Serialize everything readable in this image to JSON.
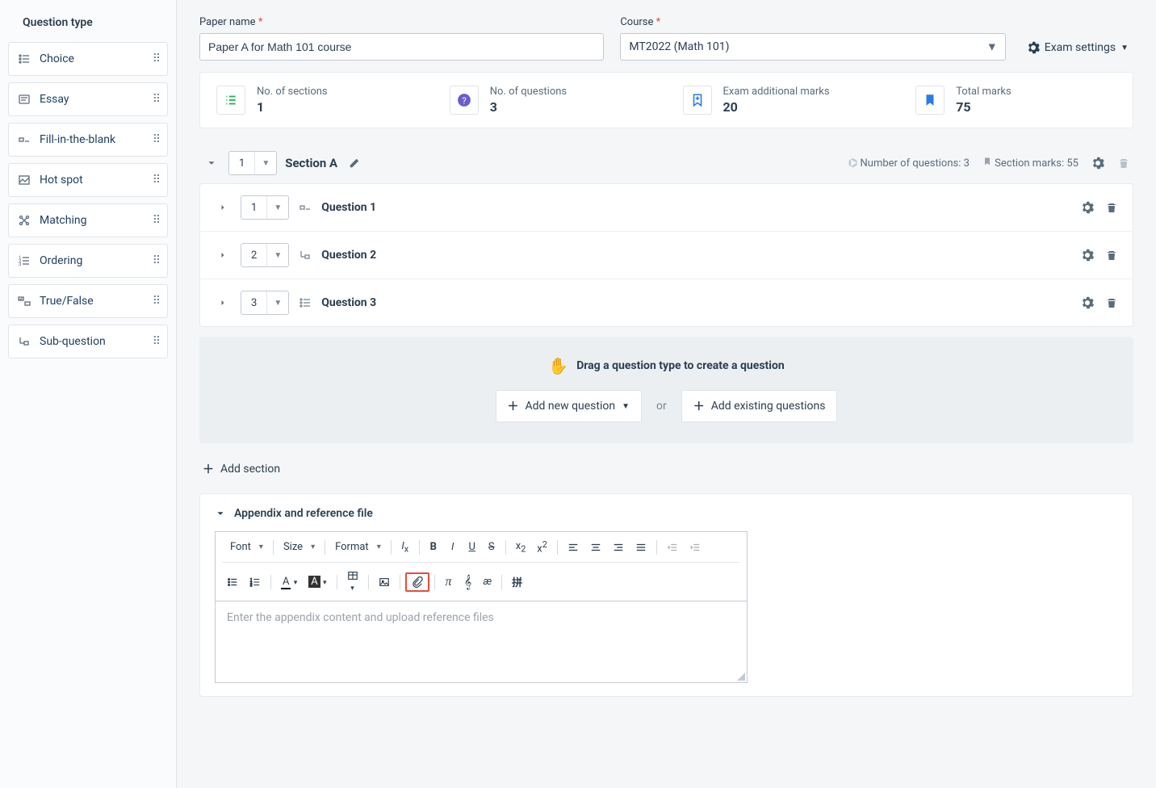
{
  "sidebar": {
    "title": "Question type",
    "items": [
      {
        "label": "Choice"
      },
      {
        "label": "Essay"
      },
      {
        "label": "Fill-in-the-blank"
      },
      {
        "label": "Hot spot"
      },
      {
        "label": "Matching"
      },
      {
        "label": "Ordering"
      },
      {
        "label": "True/False"
      },
      {
        "label": "Sub-question"
      }
    ]
  },
  "form": {
    "paperNameLabel": "Paper name",
    "paperName": "Paper A for Math 101 course",
    "courseLabel": "Course",
    "courseValue": "MT2022 (Math 101)",
    "examSettings": "Exam settings"
  },
  "summary": {
    "sectionsLabel": "No. of sections",
    "sectionsVal": "1",
    "questionsLabel": "No. of questions",
    "questionsVal": "3",
    "addMarksLabel": "Exam additional marks",
    "addMarksVal": "20",
    "totalMarksLabel": "Total marks",
    "totalMarksVal": "75"
  },
  "section": {
    "num": "1",
    "title": "Section A",
    "numQuestionsLabel": "Number of questions:",
    "numQuestionsVal": "3",
    "marksLabel": "Section marks:",
    "marksVal": "55",
    "questions": [
      {
        "num": "1",
        "title": "Question 1"
      },
      {
        "num": "2",
        "title": "Question 2"
      },
      {
        "num": "3",
        "title": "Question 3"
      }
    ]
  },
  "dropzone": {
    "dragText": "Drag a question type to create a question",
    "addNew": "Add new question",
    "or": "or",
    "addExisting": "Add existing questions"
  },
  "addSection": "Add section",
  "appendix": {
    "title": "Appendix and reference file",
    "font": "Font",
    "size": "Size",
    "format": "Format",
    "placeholder": "Enter the appendix content and upload reference files"
  }
}
